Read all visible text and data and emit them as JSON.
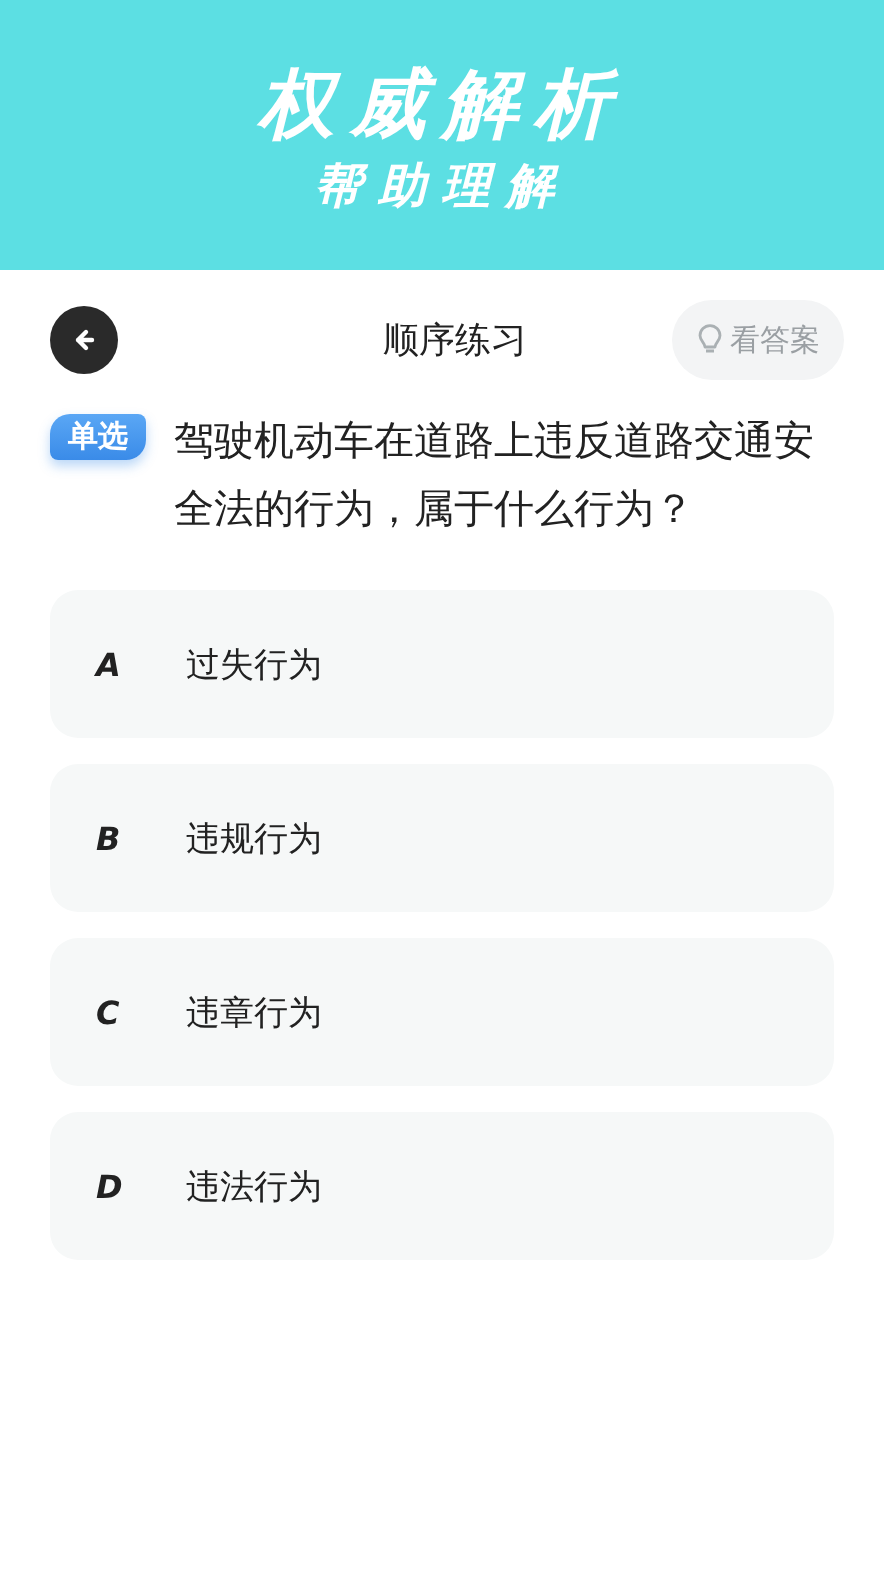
{
  "banner": {
    "title": "权威解析",
    "subtitle": "帮助理解"
  },
  "nav": {
    "title": "顺序练习",
    "answer_button": "看答案"
  },
  "question": {
    "type_badge": "单选",
    "text": "驾驶机动车在道路上违反道路交通安全法的行为，属于什么行为？"
  },
  "options": [
    {
      "letter": "A",
      "text": "过失行为",
      "selected": false
    },
    {
      "letter": "B",
      "text": "违规行为",
      "selected": false
    },
    {
      "letter": "C",
      "text": "违章行为",
      "selected": false
    },
    {
      "letter": "D",
      "text": "违法行为",
      "selected": false
    }
  ]
}
